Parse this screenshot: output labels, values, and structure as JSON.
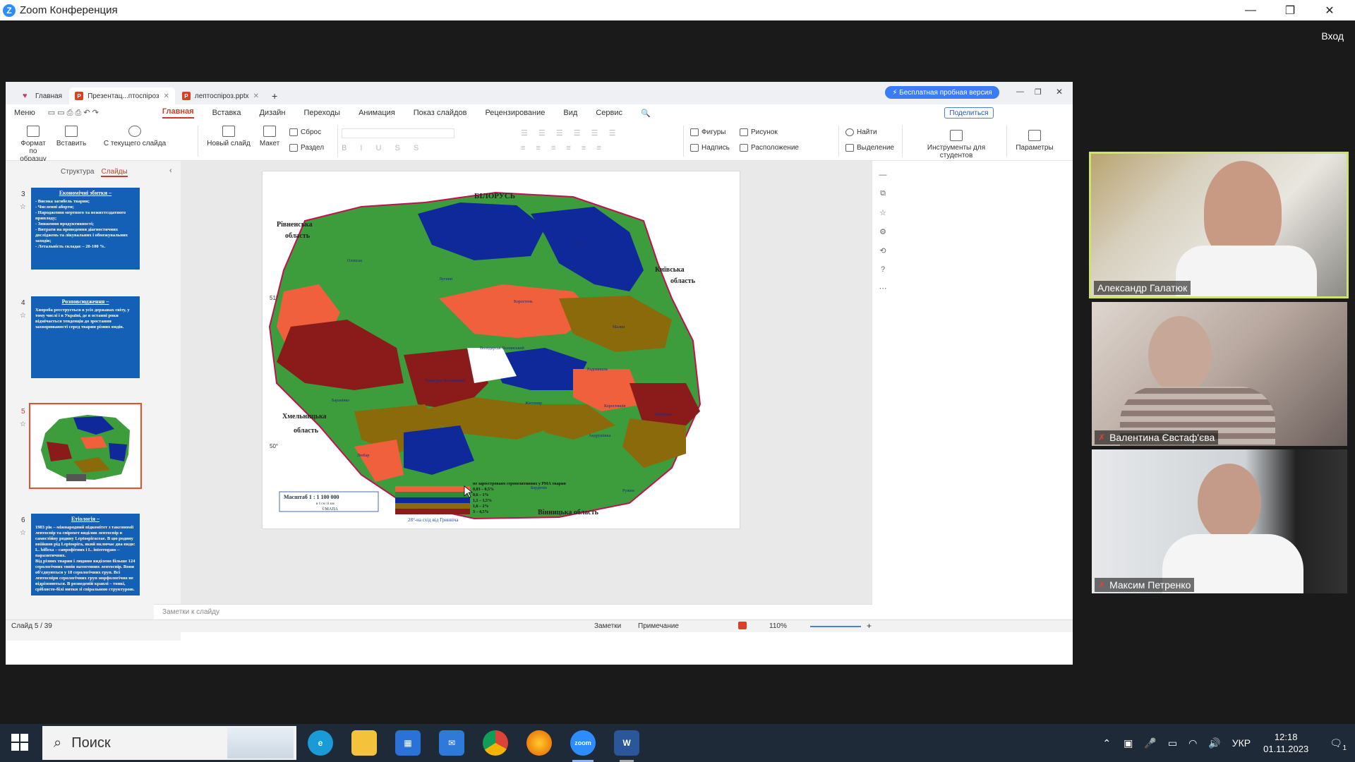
{
  "zoom": {
    "title": "Zoom Конференция",
    "login": "Вход",
    "window_controls": [
      "—",
      "❐",
      "✕"
    ]
  },
  "wps": {
    "tabs": [
      {
        "label": "Главная",
        "icon": "home-icon"
      },
      {
        "label": "Презентац...птоспіроз",
        "icon": "presentation-icon"
      },
      {
        "label": "лептоспіроз.pptx",
        "icon": "presentation-icon"
      }
    ],
    "trial_button": "⚡ Бесплатная пробная версия",
    "menu": [
      "Меню",
      "Главная",
      "Вставка",
      "Дизайн",
      "Переходы",
      "Анимация",
      "Показ слайдов",
      "Рецензирование",
      "Вид",
      "Сервис"
    ],
    "active_menu": "Главная",
    "share_button": "Поделиться",
    "ribbon": {
      "format_painter": "Формат по образцу",
      "paste": "Вставить",
      "from_current": "С текущего слайда",
      "new_slide": "Новый слайд",
      "layout": "Макет",
      "reset": "Сброс",
      "section": "Раздел",
      "shapes": "Фигуры",
      "picture": "Рисунок",
      "textbox": "Надпись",
      "arrange": "Расположение",
      "find": "Найти",
      "select": "Выделение",
      "student_tools": "Инструменты для студентов",
      "parameters": "Параметры"
    },
    "panel_tabs": {
      "structure": "Структура",
      "slides": "Слайды"
    },
    "slides": [
      {
        "num": "3",
        "title": "Економічні збитки –",
        "body": "- Висока загибель тварин;\n- Численні аборти;\n- Народження мертвого та нежиттєздатного приплоду;\n- Зниження продуктивності;\n- Витрати на проведення діагностичних досліджень та лікувальних і обмежувальних заходів;\n- Летальність складає – 20-100 %."
      },
      {
        "num": "4",
        "title": "Розповсюдження –",
        "body": "Хвороба реєструється в усіх державах світу, у тому числі і в Україні, де в останні роки відмічається тенденція до зростання захворюваності серед тварин різних видів."
      },
      {
        "num": "5",
        "title": "",
        "body": ""
      },
      {
        "num": "6",
        "title": "Етіологія –",
        "body": "1983 рік – міжнародний підкомітет з таксономії лептоспір та спірохет виділив лептоспір в самостійну родину Leptospiraceae. В цю родину ввійшов рід Leptospira, який включає два види: L. biflexa – сапрофітних і L. interrogans – паразитичних.\nВід різних тварин і людини виділено більше 124 серологічних типів патогенних лептоспір. Вони об'єднуються у 18 серологічних груп. Всі лептоспіри серологічних груп морфологічно не відрізняються. В розведеній краплі – тонкі, сріблясто-білі нитки зі спіральною структурою."
      }
    ],
    "notes_placeholder": "Заметки к слайду",
    "status": {
      "slide_counter": "Слайд 5 / 39",
      "notes": "Заметки",
      "comment": "Примечание",
      "zoom": "110%"
    },
    "map": {
      "top_label": "БІЛОРУСЬ",
      "rivne": "Рівненська\nобласть",
      "kyiv": "Київська\nобласть",
      "khmelnytskyi": "Хмельницька\nобласть",
      "vinnytsia": "Вінницька область",
      "lat51": "51°",
      "lat50": "50°",
      "scale": "Масштаб 1 : 1 100 000",
      "scale_sub": "в 1 см 11 км",
      "mapa": "©МАПА",
      "meridian": "28°-на схід від Гринвіча",
      "legend": [
        {
          "label": "не зареєстровано серопозитивних у РМА тварин",
          "color": "#3d9d3d"
        },
        {
          "label": "0,03 – 0,5%",
          "color": "#f0603d"
        },
        {
          "label": "0,6 – 1%",
          "color": "#2a8d38"
        },
        {
          "label": "1,1 – 1,5%",
          "color": "#10299a"
        },
        {
          "label": "1,6 – 2%",
          "color": "#8a6a0a"
        },
        {
          "label": "3 – 4,5%",
          "color": "#8b1a1a"
        }
      ],
      "districts": [
        "Олевськ",
        "Лугини",
        "Коростень",
        "Овруч",
        "Малин",
        "Радомишль",
        "Житомир",
        "Бердичів",
        "Андрушівка",
        "Ружин",
        "Любар",
        "Баранівка",
        "Новоград-Волинський",
        "Володарськ-Волинський",
        "Коростишів",
        "Попільня"
      ]
    }
  },
  "participants": [
    {
      "name": "Александр Галатюк",
      "muted": false,
      "active": true
    },
    {
      "name": "Валентина Євстаф'єва",
      "muted": true,
      "active": false
    },
    {
      "name": "Максим Петренко",
      "muted": true,
      "active": false
    }
  ],
  "taskbar": {
    "search": "Поиск",
    "apps": [
      {
        "name": "edge",
        "color": "#1a9ad6"
      },
      {
        "name": "explorer",
        "color": "#f5c33b"
      },
      {
        "name": "store",
        "color": "#2b72d8"
      },
      {
        "name": "mail",
        "color": "#2f7ad8"
      },
      {
        "name": "chrome",
        "color": "#db4437"
      },
      {
        "name": "firefox",
        "color": "#e66000"
      },
      {
        "name": "zoom",
        "color": "#2d8cff"
      },
      {
        "name": "word",
        "color": "#2b579a"
      }
    ],
    "language": "УКР",
    "time": "12:18",
    "date": "01.11.2023",
    "notifications": "1"
  }
}
